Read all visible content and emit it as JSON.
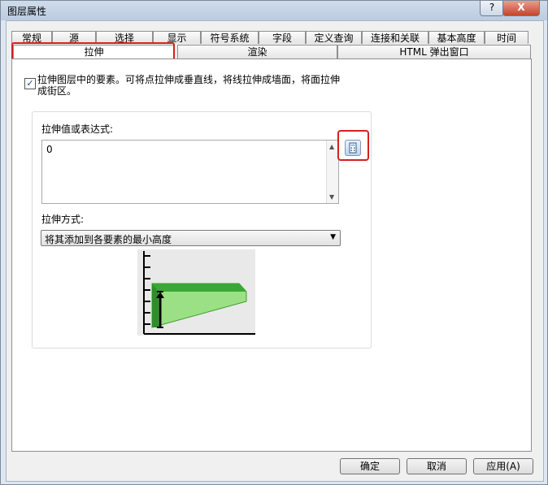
{
  "window": {
    "title": "图层属性"
  },
  "titlebar": {
    "help_label": "?",
    "close_label": "X"
  },
  "tabs_row1": [
    "常规",
    "源",
    "选择",
    "显示",
    "符号系统",
    "字段",
    "定义查询",
    "连接和关联",
    "基本高度",
    "时间"
  ],
  "tabs_row2": [
    "拉伸",
    "渲染",
    "HTML 弹出窗口"
  ],
  "selected_tab": "拉伸",
  "extrude": {
    "checkbox_checked": true,
    "checkbox_label": "拉伸图层中的要素。可将点拉伸成垂直线，将线拉伸成墙面，将面拉伸成街区。",
    "expression_label": "拉伸值或表达式:",
    "expression_value": "0",
    "calculator_icon": "calculator-icon",
    "method_label": "拉伸方式:",
    "method_value": "将其添加到各要素的最小高度"
  },
  "buttons": {
    "ok": "确定",
    "cancel": "取消",
    "apply": "应用(A)"
  },
  "colors": {
    "highlight": "#d42020",
    "illustration_green": "#7bd26a"
  }
}
